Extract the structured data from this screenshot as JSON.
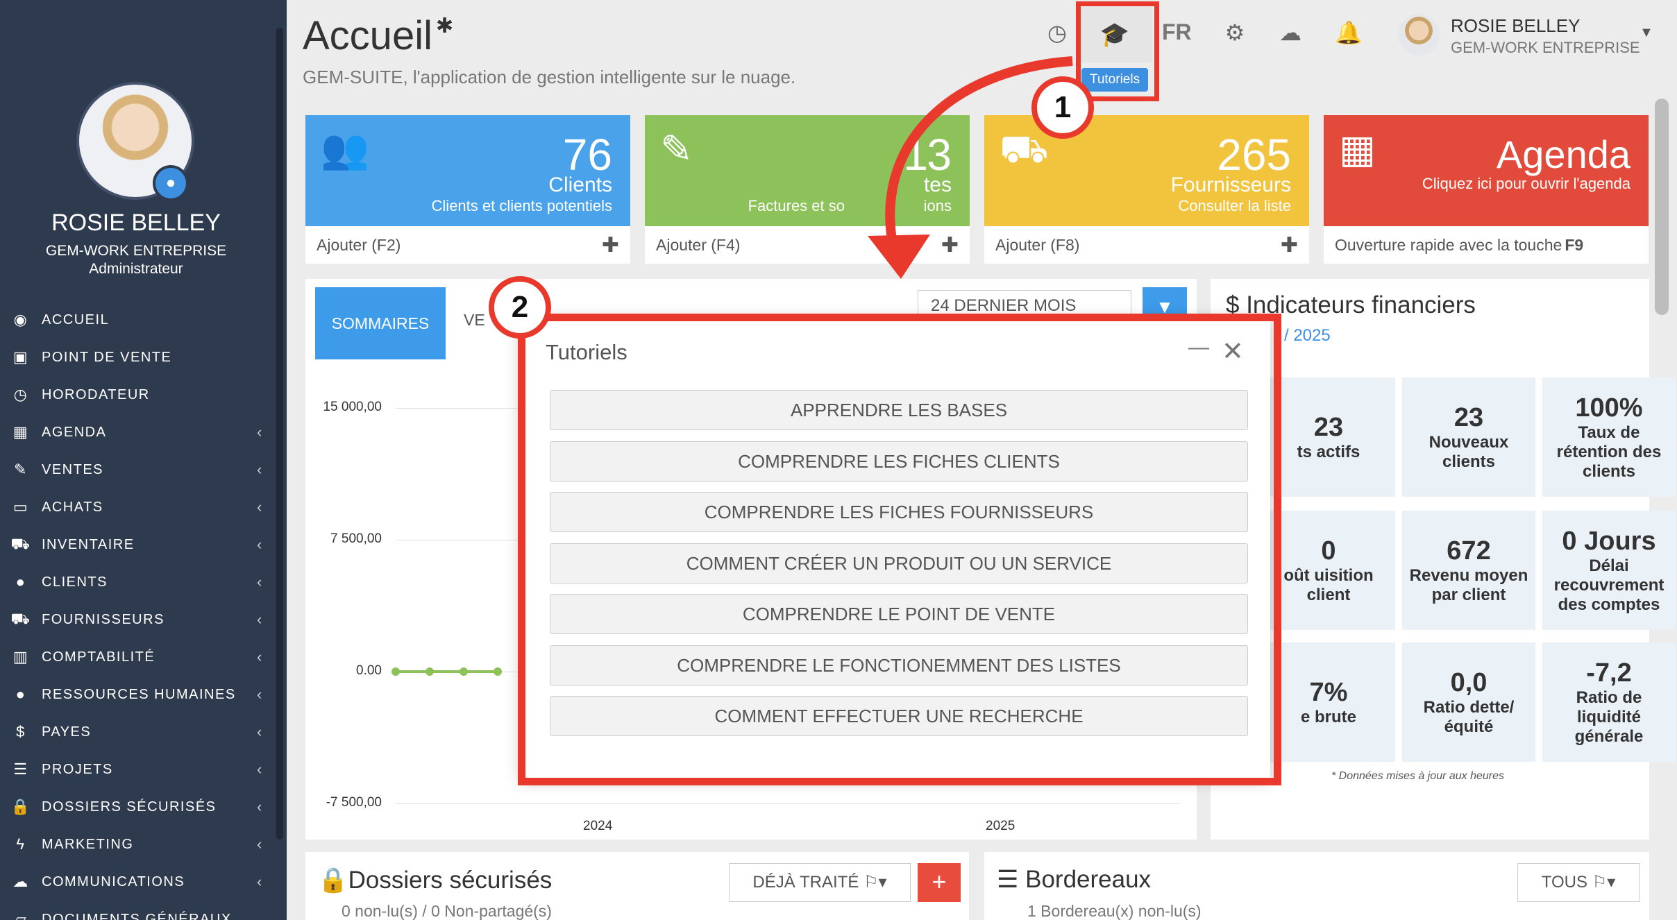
{
  "sidebar": {
    "user_name": "ROSIE BELLEY",
    "company": "GEM-WORK ENTREPRISE",
    "role": "Administrateur",
    "menu": [
      {
        "label": "ACCUEIL",
        "icon": "dashboard-icon",
        "glyph": "◉",
        "chevron": false
      },
      {
        "label": "POINT DE VENTE",
        "icon": "cash-icon",
        "glyph": "▣",
        "chevron": false
      },
      {
        "label": "HORODATEUR",
        "icon": "clock-icon",
        "glyph": "◷",
        "chevron": false
      },
      {
        "label": "AGENDA",
        "icon": "calendar-icon",
        "glyph": "▦",
        "chevron": true
      },
      {
        "label": "VENTES",
        "icon": "edit-icon",
        "glyph": "✎",
        "chevron": true
      },
      {
        "label": "ACHATS",
        "icon": "credit-card-icon",
        "glyph": "▭",
        "chevron": true
      },
      {
        "label": "INVENTAIRE",
        "icon": "cart-icon",
        "glyph": "⛟",
        "chevron": true
      },
      {
        "label": "CLIENTS",
        "icon": "users-icon",
        "glyph": "●",
        "chevron": true
      },
      {
        "label": "FOURNISSEURS",
        "icon": "truck-icon",
        "glyph": "⛟",
        "chevron": true
      },
      {
        "label": "COMPTABILITÉ",
        "icon": "bar-chart-icon",
        "glyph": "▥",
        "chevron": true
      },
      {
        "label": "RESSOURCES HUMAINES",
        "icon": "user-icon",
        "glyph": "●",
        "chevron": true
      },
      {
        "label": "PAYES",
        "icon": "dollar-icon",
        "glyph": "$",
        "chevron": true
      },
      {
        "label": "PROJETS",
        "icon": "tasks-icon",
        "glyph": "☰",
        "chevron": true
      },
      {
        "label": "DOSSIERS SÉCURISÉS",
        "icon": "lock-icon",
        "glyph": "🔒",
        "chevron": true
      },
      {
        "label": "MARKETING",
        "icon": "bolt-icon",
        "glyph": "ϟ",
        "chevron": true
      },
      {
        "label": "COMMUNICATIONS",
        "icon": "comments-icon",
        "glyph": "☁",
        "chevron": true
      },
      {
        "label": "DOCUMENTS GÉNÉRAUX",
        "icon": "folder-icon",
        "glyph": "▱",
        "chevron": false
      }
    ]
  },
  "header": {
    "title": "Accueil",
    "subtitle": "GEM-SUITE, l'application de gestion intelligente sur le nuage.",
    "tutorial_tooltip": "Tutoriels",
    "language": "FR",
    "user_name": "ROSIE BELLEY",
    "user_company": "GEM-WORK ENTREPRISE"
  },
  "cards": [
    {
      "value": "76",
      "label": "Clients",
      "sub": "Clients et clients potentiels",
      "action": "Ajouter (F2)",
      "color": "#4aa3ea",
      "icon": "users-icon"
    },
    {
      "value": "1_3",
      "label": "__tes",
      "sub": "Factures et so__ions",
      "action": "Ajouter (F4)",
      "color": "#8dc15a",
      "icon": "edit-icon"
    },
    {
      "value": "265",
      "label": "Fournisseurs",
      "sub": "Consulter la liste",
      "action": "Ajouter (F8)",
      "color": "#f2c33d",
      "icon": "truck-icon"
    },
    {
      "value": "Agenda",
      "label": "",
      "sub": "Cliquez ici pour ouvrir l'agenda",
      "action": "Ouverture rapide avec la touche ",
      "action_key": "F9",
      "color": "#e24b3b",
      "icon": "calendar-icon"
    }
  ],
  "card_texts": {
    "c1_value": "76",
    "c1_label": "Clients",
    "c1_sub": "Clients et clients potentiels",
    "c1_action": "Ajouter (F2)",
    "c2_value_a": "1",
    "c2_value_b": "3",
    "c2_label": "tes",
    "c2_sub_a": "Factures et so",
    "c2_sub_b": "ions",
    "c2_action": "Ajouter (F4)",
    "c3_value": "265",
    "c3_label": "Fournisseurs",
    "c3_sub": "Consulter la liste",
    "c3_action": "Ajouter (F8)",
    "c4_value": "Agenda",
    "c4_sub": "Cliquez ici pour ouvrir l'agenda",
    "c4_action": "Ouverture rapide avec la touche ",
    "c4_key": "F9"
  },
  "summary": {
    "tab_active": "SOMMAIRES",
    "tab_other": "VE",
    "period": "24 DERNIER MOIS"
  },
  "chart_data": {
    "type": "line",
    "x_tick_labels": [
      "2024",
      "2025"
    ],
    "y_tick_labels": [
      "15 000,00",
      "7 500,00",
      "0.00",
      "-7 500,00"
    ],
    "ylim": [
      -7500,
      15000
    ],
    "series": [
      {
        "color": "#8dc15a",
        "values": [
          0,
          0,
          0,
          0
        ]
      }
    ]
  },
  "financial": {
    "title": "Indicateurs financiers",
    "year": "/ 2025",
    "tiles": [
      {
        "value": "23",
        "label": "ts actifs"
      },
      {
        "value": "23",
        "label": "Nouveaux clients"
      },
      {
        "value": "100%",
        "label": "Taux de rétention des clients"
      },
      {
        "value": "0",
        "label": "oût uisition client"
      },
      {
        "value": "672",
        "label": "Revenu moyen par client"
      },
      {
        "value": "0 Jours",
        "label": "Délai recouvrement des comptes"
      },
      {
        "value": "7%",
        "label": "e brute"
      },
      {
        "value": "0,0",
        "label": "Ratio dette/ équité"
      },
      {
        "value": "-7,2",
        "label": "Ratio de liquidité générale"
      }
    ],
    "footnote": "* Données mises à jour aux heures"
  },
  "dossiers": {
    "title": "Dossiers sécurisés",
    "subtitle": "0 non-lu(s) / 0 Non-partagé(s)",
    "filter": "DÉJÀ TRAITÉ"
  },
  "bordereaux": {
    "title": "Bordereaux",
    "subtitle": "1 Bordereau(x) non-lu(s)",
    "filter": "TOUS"
  },
  "modal": {
    "title": "Tutoriels",
    "buttons": [
      "APPRENDRE LES BASES",
      "COMPRENDRE LES FICHES CLIENTS",
      "COMPRENDRE LES FICHES FOURNISSEURS",
      "COMMENT CRÉER UN PRODUIT OU UN SERVICE",
      "COMPRENDRE LE POINT DE VENTE",
      "COMPRENDRE LE FONCTIONEMMENT DES LISTES",
      "COMMENT EFFECTUER UNE RECHERCHE"
    ]
  },
  "annotations": {
    "step1": "1",
    "step2": "2",
    "color": "#e8392c"
  }
}
